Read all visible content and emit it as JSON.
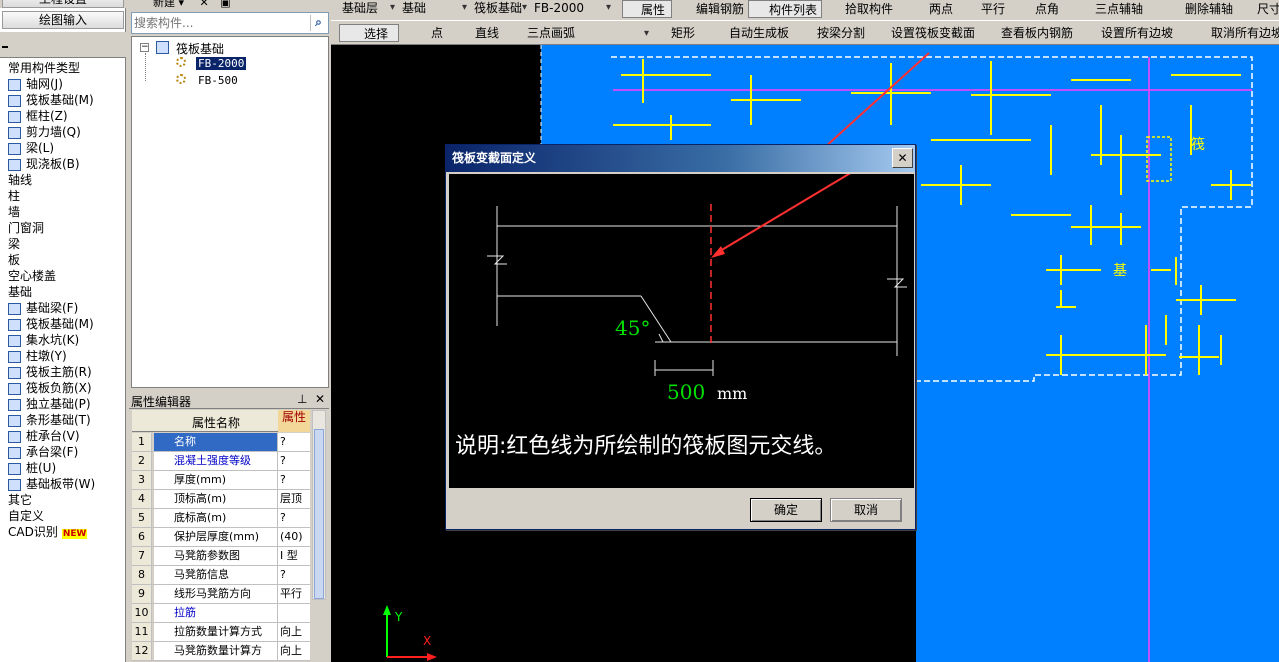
{
  "left_panel": {
    "top_buttons": [
      "工程设置",
      "绘图输入"
    ],
    "tree": [
      {
        "label": "常用构件类型",
        "level": 0
      },
      {
        "label": "轴网(J)",
        "level": 1
      },
      {
        "label": "筏板基础(M)",
        "level": 1
      },
      {
        "label": "框柱(Z)",
        "level": 1
      },
      {
        "label": "剪力墙(Q)",
        "level": 1
      },
      {
        "label": "梁(L)",
        "level": 1
      },
      {
        "label": "现浇板(B)",
        "level": 1
      },
      {
        "label": "轴线",
        "level": 0
      },
      {
        "label": "柱",
        "level": 0
      },
      {
        "label": "墙",
        "level": 0
      },
      {
        "label": "门窗洞",
        "level": 0
      },
      {
        "label": "梁",
        "level": 0
      },
      {
        "label": "板",
        "level": 0
      },
      {
        "label": "空心楼盖",
        "level": 0
      },
      {
        "label": "基础",
        "level": 0
      },
      {
        "label": "基础梁(F)",
        "level": 1
      },
      {
        "label": "筏板基础(M)",
        "level": 1
      },
      {
        "label": "集水坑(K)",
        "level": 1
      },
      {
        "label": "柱墩(Y)",
        "level": 1
      },
      {
        "label": "筏板主筋(R)",
        "level": 1
      },
      {
        "label": "筏板负筋(X)",
        "level": 1
      },
      {
        "label": "独立基础(P)",
        "level": 1
      },
      {
        "label": "条形基础(T)",
        "level": 1
      },
      {
        "label": "桩承台(V)",
        "level": 1
      },
      {
        "label": "承台梁(F)",
        "level": 1
      },
      {
        "label": "桩(U)",
        "level": 1
      },
      {
        "label": "基础板带(W)",
        "level": 1
      },
      {
        "label": "其它",
        "level": 0
      },
      {
        "label": "自定义",
        "level": 0
      },
      {
        "label": "CAD识别",
        "level": 0
      }
    ],
    "new_badge": "NEW"
  },
  "component_panel": {
    "toolbar": {
      "new_label": "新建"
    },
    "search_placeholder": "搜索构件...",
    "root": "筏板基础",
    "items": [
      "FB-2000",
      "FB-500"
    ],
    "selected": "FB-2000"
  },
  "property_editor": {
    "title": "属性编辑器",
    "col_name": "属性名称",
    "col_value": "属性",
    "rows": [
      {
        "n": "1",
        "name": "名称",
        "value": "?",
        "blue": false
      },
      {
        "n": "2",
        "name": "混凝土强度等级",
        "value": "?",
        "blue": true
      },
      {
        "n": "3",
        "name": "厚度(mm)",
        "value": "?",
        "blue": false
      },
      {
        "n": "4",
        "name": "顶标高(m)",
        "value": "层顶",
        "blue": false
      },
      {
        "n": "5",
        "name": "底标高(m)",
        "value": "?",
        "blue": false
      },
      {
        "n": "6",
        "name": "保护层厚度(mm)",
        "value": "(40)",
        "blue": false
      },
      {
        "n": "7",
        "name": "马凳筋参数图",
        "value": "I 型",
        "blue": false
      },
      {
        "n": "8",
        "name": "马凳筋信息",
        "value": "?",
        "blue": false
      },
      {
        "n": "9",
        "name": "线形马凳筋方向",
        "value": "平行",
        "blue": false
      },
      {
        "n": "10",
        "name": "拉筋",
        "value": "",
        "blue": true
      },
      {
        "n": "11",
        "name": "拉筋数量计算方式",
        "value": "向上",
        "blue": false
      },
      {
        "n": "12",
        "name": "马凳筋数量计算方",
        "value": "向上",
        "blue": false
      }
    ]
  },
  "toolbar1": {
    "floor_select": "基础层",
    "category_select": "基础",
    "type_select": "筏板基础",
    "item_select": "FB-2000",
    "buttons": [
      "属性",
      "编辑钢筋",
      "构件列表",
      "拾取构件",
      "两点",
      "平行",
      "点角",
      "三点辅轴",
      "删除辅轴",
      "尺寸"
    ]
  },
  "toolbar2": {
    "buttons": [
      "选择",
      "点",
      "直线",
      "三点画弧",
      "矩形",
      "自动生成板",
      "按梁分割",
      "设置筏板变截面",
      "查看板内钢筋",
      "设置所有边坡",
      "取消所有边坡"
    ]
  },
  "dialog": {
    "title": "筏板变截面定义",
    "angle_label": "45°",
    "dim_value": "500",
    "dim_unit": "mm",
    "description": "说明:红色线为所绘制的筏板图元交线。",
    "ok_label": "确定",
    "cancel_label": "取消"
  },
  "canvas": {
    "axis_y": "Y",
    "axis_x": "X",
    "label_a": "筏",
    "label_b": "基"
  }
}
